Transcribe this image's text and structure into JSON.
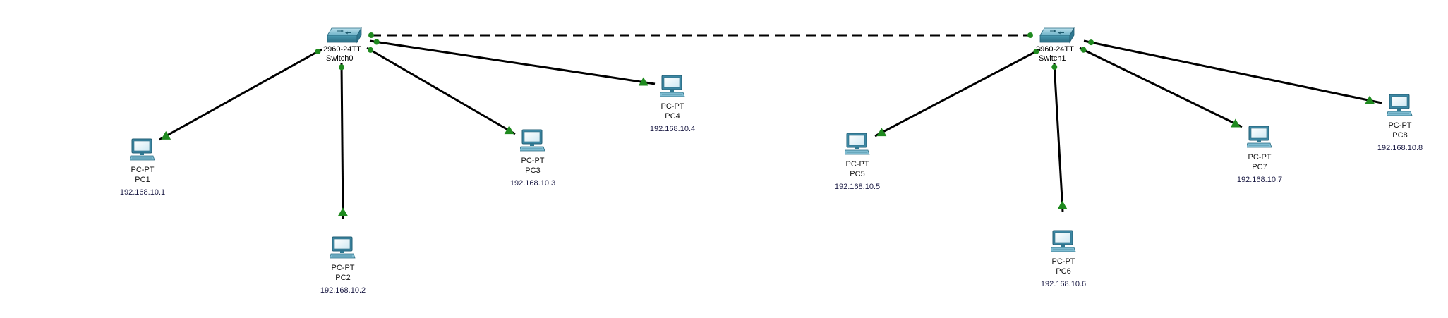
{
  "colors": {
    "cable": "#000000",
    "link_up": "#1f8a1f",
    "switch_body": "#3f8fa6",
    "switch_top": "#8fc7d8",
    "pc_frame": "#3d87a3",
    "pc_screen": "#e9f6fb"
  },
  "switches": [
    {
      "id": "sw0",
      "model": "2960-24TT",
      "name": "Switch0",
      "icon": "switch-icon"
    },
    {
      "id": "sw1",
      "model": "2960-24TT",
      "name": "Switch1",
      "icon": "switch-icon"
    }
  ],
  "pcs": [
    {
      "id": "pc1",
      "model": "PC-PT",
      "name": "PC1",
      "ip": "192.168.10.1",
      "icon": "pc-icon"
    },
    {
      "id": "pc2",
      "model": "PC-PT",
      "name": "PC2",
      "ip": "192.168.10.2",
      "icon": "pc-icon"
    },
    {
      "id": "pc3",
      "model": "PC-PT",
      "name": "PC3",
      "ip": "192.168.10.3",
      "icon": "pc-icon"
    },
    {
      "id": "pc4",
      "model": "PC-PT",
      "name": "PC4",
      "ip": "192.168.10.4",
      "icon": "pc-icon"
    },
    {
      "id": "pc5",
      "model": "PC-PT",
      "name": "PC5",
      "ip": "192.168.10.5",
      "icon": "pc-icon"
    },
    {
      "id": "pc6",
      "model": "PC-PT",
      "name": "PC6",
      "ip": "192.168.10.6",
      "icon": "pc-icon"
    },
    {
      "id": "pc7",
      "model": "PC-PT",
      "name": "PC7",
      "ip": "192.168.10.7",
      "icon": "pc-icon"
    },
    {
      "id": "pc8",
      "model": "PC-PT",
      "name": "PC8",
      "ip": "192.168.10.8",
      "icon": "pc-icon"
    }
  ],
  "links": [
    {
      "from": "sw0",
      "to": "pc1",
      "style": "straight"
    },
    {
      "from": "sw0",
      "to": "pc2",
      "style": "straight"
    },
    {
      "from": "sw0",
      "to": "pc3",
      "style": "straight"
    },
    {
      "from": "sw0",
      "to": "pc4",
      "style": "straight"
    },
    {
      "from": "sw1",
      "to": "pc5",
      "style": "straight"
    },
    {
      "from": "sw1",
      "to": "pc6",
      "style": "straight"
    },
    {
      "from": "sw1",
      "to": "pc7",
      "style": "straight"
    },
    {
      "from": "sw1",
      "to": "pc8",
      "style": "straight"
    },
    {
      "from": "sw0",
      "to": "sw1",
      "style": "crossover"
    }
  ]
}
